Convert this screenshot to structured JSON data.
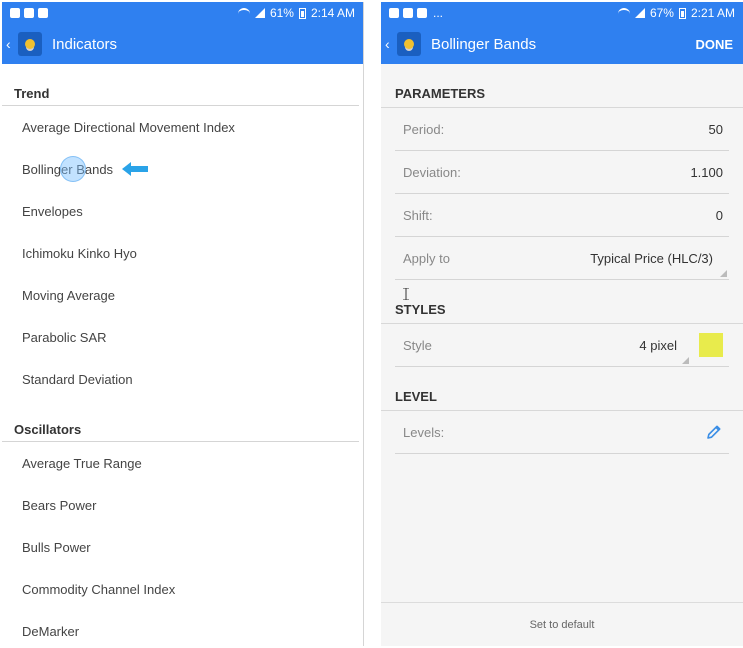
{
  "left": {
    "status": {
      "battery": "61%",
      "time": "2:14 AM"
    },
    "title": "Indicators",
    "sections": [
      {
        "header": "Trend",
        "items": [
          "Average Directional Movement Index",
          "Bollinger Bands",
          "Envelopes",
          "Ichimoku Kinko Hyo",
          "Moving Average",
          "Parabolic SAR",
          "Standard Deviation"
        ]
      },
      {
        "header": "Oscillators",
        "items": [
          "Average True Range",
          "Bears Power",
          "Bulls Power",
          "Commodity Channel Index",
          "DeMarker"
        ]
      }
    ]
  },
  "right": {
    "status": {
      "dots": "...",
      "battery": "67%",
      "time": "2:21 AM"
    },
    "title": "Bollinger Bands",
    "done_label": "DONE",
    "parameters_header": "PARAMETERS",
    "period": {
      "label": "Period:",
      "value": "50"
    },
    "deviation": {
      "label": "Deviation:",
      "value": "1.100"
    },
    "shift": {
      "label": "Shift:",
      "value": "0"
    },
    "apply_to": {
      "label": "Apply to",
      "value": "Typical Price (HLC/3)"
    },
    "styles_header": "STYLES",
    "style": {
      "label": "Style",
      "value": "4 pixel",
      "color": "#e8eb4c"
    },
    "level_header": "LEVEL",
    "levels": {
      "label": "Levels:"
    },
    "footer": "Set to default"
  },
  "colors": {
    "accent": "#2f80f0",
    "pencil": "#3a8ee6",
    "arrow": "#2aa3e8"
  }
}
